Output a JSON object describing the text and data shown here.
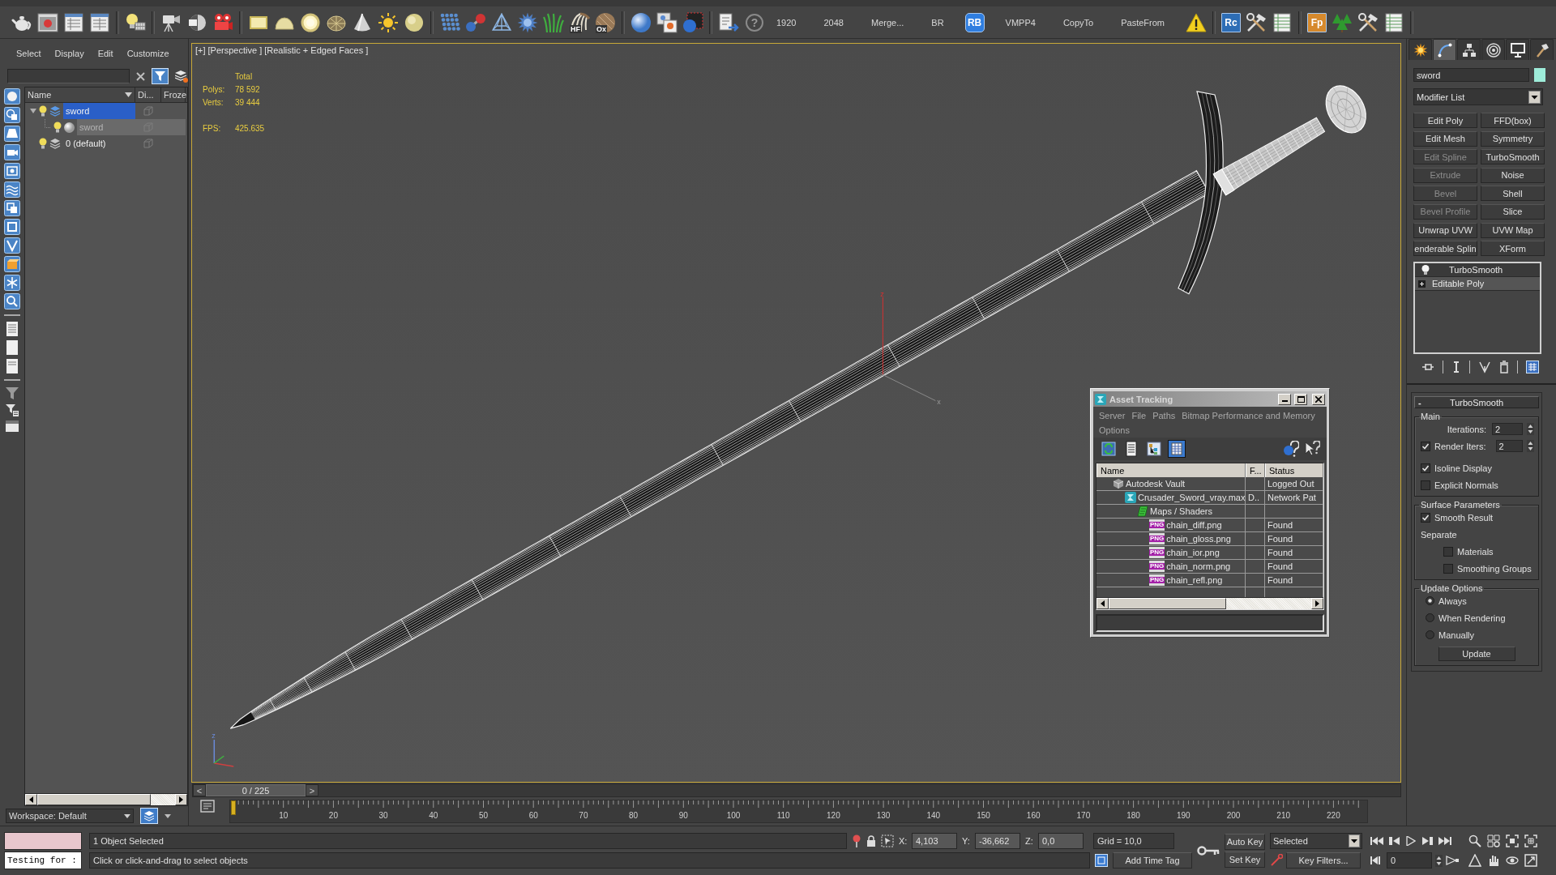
{
  "main_toolbar": {
    "icon_labels": [
      "HF",
      "Ox"
    ],
    "help": "?",
    "script_buttons": [
      {
        "kind": "text",
        "label": "1920"
      },
      {
        "kind": "text",
        "label": "2048"
      },
      {
        "kind": "text",
        "label": "Merge..."
      },
      {
        "kind": "text",
        "label": "BR"
      },
      {
        "kind": "logo",
        "label": "RB",
        "color": "#2f7ee0"
      },
      {
        "kind": "text",
        "label": "VMPP4"
      },
      {
        "kind": "text",
        "label": "CopyTo"
      },
      {
        "kind": "text",
        "label": "PasteFrom"
      }
    ],
    "logo_tiles": [
      {
        "label": "Rc",
        "color": "#2d6db5"
      },
      {
        "label": "Fp",
        "color": "#d6892c"
      }
    ]
  },
  "scene_explorer": {
    "menu": [
      "Select",
      "Display",
      "Edit",
      "Customize"
    ],
    "columns": [
      "Name",
      "Di...",
      "Froze"
    ],
    "tree": [
      {
        "kind": "layer",
        "name": "sword",
        "selected": true,
        "expanded": true,
        "children": [
          {
            "kind": "object",
            "name": "sword",
            "selected": true
          }
        ]
      },
      {
        "kind": "layer",
        "name": "0 (default)",
        "selected": false
      }
    ],
    "workspace": "Workspace: Default"
  },
  "viewport": {
    "active": true,
    "labels": [
      "[+]",
      "[Perspective ]",
      "[Realistic + Edged Faces ]"
    ],
    "stats": {
      "heading": "Total",
      "rows": [
        {
          "label": "Polys:",
          "value": "78 592"
        },
        {
          "label": "Verts:",
          "value": "39 444"
        }
      ],
      "fps_label": "FPS:",
      "fps": "425.635"
    },
    "gizmo_labels": [
      "z",
      "x"
    ],
    "tripod_label": "z"
  },
  "asset_tracking": {
    "title": "Asset Tracking",
    "menu": [
      "Server",
      "File",
      "Paths",
      "Bitmap Performance and Memory",
      "Options"
    ],
    "tools": [
      {
        "selected": false
      },
      {
        "selected": false
      },
      {
        "selected": false
      },
      {
        "selected": true
      }
    ],
    "columns": [
      "Name",
      "F...",
      "Status"
    ],
    "rows": [
      {
        "kind": "vault",
        "name": "Autodesk Vault",
        "status": "Logged Out",
        "children": [
          {
            "kind": "scene",
            "name": "Crusader_Sword_vray.max",
            "f": "D..",
            "status": "Network Pat",
            "children": [
              {
                "kind": "folder",
                "name": "Maps / Shaders",
                "children": [
                  {
                    "kind": "png",
                    "badge": "PNG",
                    "name": "chain_diff.png",
                    "status": "Found"
                  },
                  {
                    "kind": "png",
                    "badge": "PNG",
                    "name": "chain_gloss.png",
                    "status": "Found"
                  },
                  {
                    "kind": "png",
                    "badge": "PNG",
                    "name": "chain_ior.png",
                    "status": "Found"
                  },
                  {
                    "kind": "png",
                    "badge": "PNG",
                    "name": "chain_norm.png",
                    "status": "Found"
                  },
                  {
                    "kind": "png",
                    "badge": "PNG",
                    "name": "chain_refl.png",
                    "status": "Found"
                  }
                ]
              }
            ]
          }
        ]
      }
    ]
  },
  "command_panel": {
    "tabs": [
      {
        "selected": false
      },
      {
        "selected": true
      },
      {
        "selected": false
      },
      {
        "selected": false
      },
      {
        "selected": false
      },
      {
        "selected": false
      }
    ],
    "object_name": "sword",
    "modifier_list": "Modifier List",
    "modifier_buttons": [
      {
        "label": "Edit Poly",
        "disabled": false
      },
      {
        "label": "FFD(box)",
        "disabled": false
      },
      {
        "label": "Edit Mesh",
        "disabled": false
      },
      {
        "label": "Symmetry",
        "disabled": false
      },
      {
        "label": "Edit Spline",
        "disabled": true
      },
      {
        "label": "TurboSmooth",
        "disabled": false
      },
      {
        "label": "Extrude",
        "disabled": true
      },
      {
        "label": "Noise",
        "disabled": false
      },
      {
        "label": "Bevel",
        "disabled": true
      },
      {
        "label": "Shell",
        "disabled": false
      },
      {
        "label": "Bevel Profile",
        "disabled": true
      },
      {
        "label": "Slice",
        "disabled": false
      },
      {
        "label": "Unwrap UVW",
        "disabled": false
      },
      {
        "label": "UVW Map",
        "disabled": false
      },
      {
        "label": "enderable Splin",
        "disabled": false
      },
      {
        "label": "XForm",
        "disabled": false
      }
    ],
    "stack": [
      {
        "kind": "modifier",
        "name": "TurboSmooth"
      },
      {
        "kind": "base",
        "name": "Editable Poly",
        "expanded": false
      }
    ],
    "rollout": {
      "toggle": "-",
      "title": "TurboSmooth",
      "groups": [
        {
          "title": "Main",
          "items": [
            {
              "kind": "spinner",
              "label": "Iterations:",
              "value": "2"
            },
            {
              "kind": "check_spinner",
              "label": "Render Iters:",
              "checked": true,
              "value": "2"
            },
            {
              "kind": "checkbox",
              "label": "Isoline Display",
              "checked": true
            },
            {
              "kind": "checkbox",
              "label": "Explicit Normals",
              "checked": false
            }
          ]
        },
        {
          "title": "Surface Parameters",
          "items": [
            {
              "kind": "checkbox",
              "label": "Smooth Result",
              "checked": true
            },
            {
              "kind": "label",
              "label": "Separate",
              "children": [
                {
                  "kind": "checkbox",
                  "label": "Materials",
                  "checked": false
                },
                {
                  "kind": "checkbox",
                  "label": "Smoothing Groups",
                  "checked": false
                }
              ]
            }
          ]
        },
        {
          "title": "Update Options",
          "items": [
            {
              "kind": "radio",
              "label": "Always",
              "selected": true
            },
            {
              "kind": "radio",
              "label": "When Rendering",
              "selected": false
            },
            {
              "kind": "radio",
              "label": "Manually",
              "selected": false
            },
            {
              "kind": "button",
              "label": "Update"
            }
          ]
        }
      ]
    }
  },
  "timeline": {
    "slider": {
      "prev": "<",
      "label": "0 / 225",
      "next": ">",
      "level": 0
    },
    "frame_labels": [
      "10",
      "20",
      "30",
      "40",
      "50",
      "60",
      "70",
      "80",
      "90",
      "100",
      "110",
      "120",
      "130",
      "140",
      "150",
      "160",
      "170",
      "180",
      "190",
      "200",
      "210",
      "220"
    ]
  },
  "status_bar": {
    "listener": "Testing for :",
    "selection": "1 Object Selected",
    "prompt": "Click or click-and-drag to select objects",
    "coords": [
      {
        "axis": "X:",
        "value": "4,103"
      },
      {
        "axis": "Y:",
        "value": "-36,662"
      },
      {
        "axis": "Z:",
        "value": "0,0"
      }
    ],
    "grid": "Grid = 10,0",
    "add_time_tag": "Add Time Tag",
    "auto_key": "Auto Key",
    "set_key": "Set Key",
    "key_mode": "Selected",
    "key_filters": "Key Filters...",
    "frame": "0"
  }
}
